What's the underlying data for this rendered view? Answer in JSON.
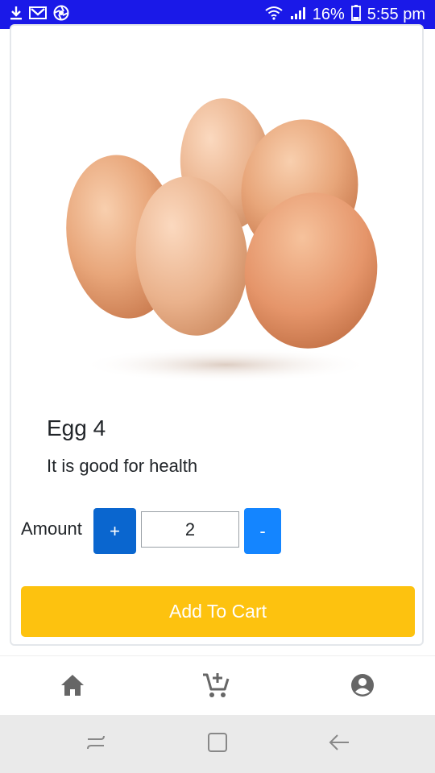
{
  "status_bar": {
    "battery_percent": "16%",
    "time": "5:55 pm",
    "icons": [
      "download-icon",
      "gmail-icon",
      "aperture-icon",
      "wifi-icon",
      "signal-icon",
      "battery-icon"
    ],
    "background_color": "#1a19e8"
  },
  "product": {
    "image_icon": "eggs-photo",
    "title": "Egg 4",
    "description": "It is good for health"
  },
  "quantity": {
    "label": "Amount",
    "plus_label": "+",
    "value": "2",
    "minus_label": "-",
    "plus_color": "#0a66cf",
    "minus_color": "#1485ff"
  },
  "cart": {
    "add_label": "Add To Cart",
    "color": "#fdc20f"
  },
  "bottom_nav": {
    "items": [
      {
        "icon": "home-icon"
      },
      {
        "icon": "add-to-cart-icon"
      },
      {
        "icon": "account-icon"
      }
    ]
  },
  "system_nav": {
    "items": [
      {
        "icon": "recent-apps-icon"
      },
      {
        "icon": "home-square-icon"
      },
      {
        "icon": "back-arrow-icon"
      }
    ]
  }
}
